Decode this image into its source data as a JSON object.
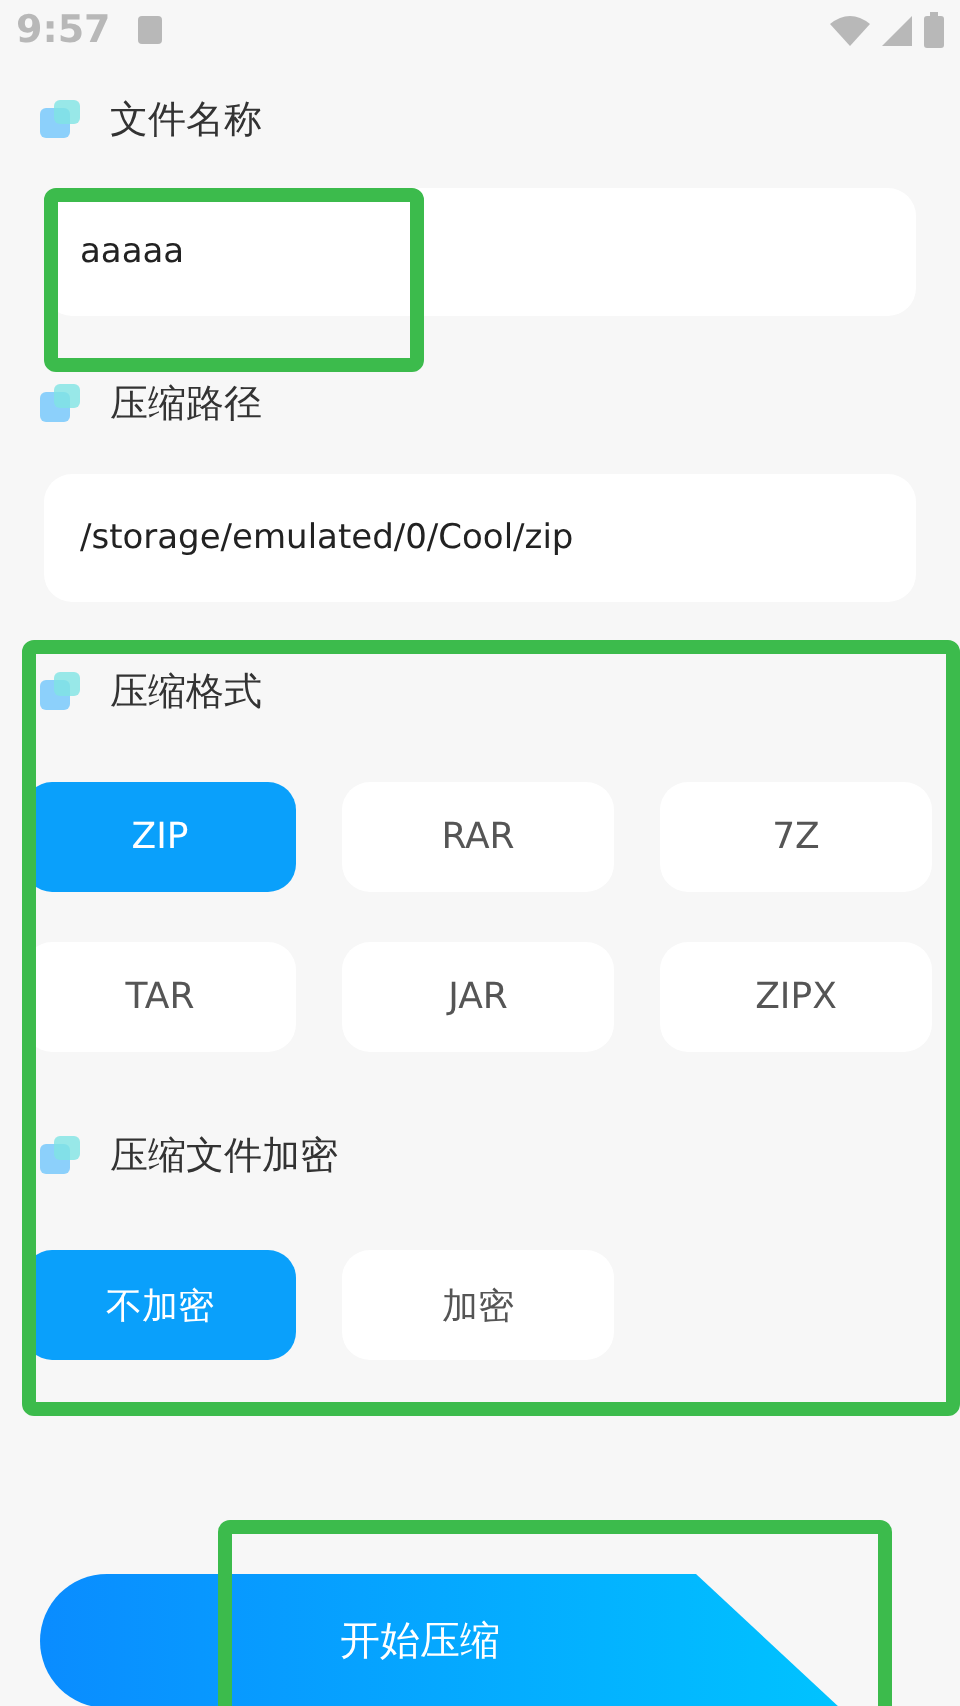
{
  "status_bar": {
    "time": "9:57"
  },
  "file_name": {
    "label": "文件名称",
    "value": "aaaaa"
  },
  "path": {
    "label": "压缩路径",
    "value": "/storage/emulated/0/Cool/zip"
  },
  "format": {
    "label": "压缩格式",
    "options": [
      {
        "label": "ZIP",
        "selected": true
      },
      {
        "label": "RAR",
        "selected": false
      },
      {
        "label": "7Z",
        "selected": false
      },
      {
        "label": "TAR",
        "selected": false
      },
      {
        "label": "JAR",
        "selected": false
      },
      {
        "label": "ZIPX",
        "selected": false
      }
    ]
  },
  "encryption": {
    "label": "压缩文件加密",
    "options": [
      {
        "label": "不加密",
        "selected": true
      },
      {
        "label": "加密",
        "selected": false
      }
    ]
  },
  "start_button": {
    "label": "开始压缩"
  }
}
